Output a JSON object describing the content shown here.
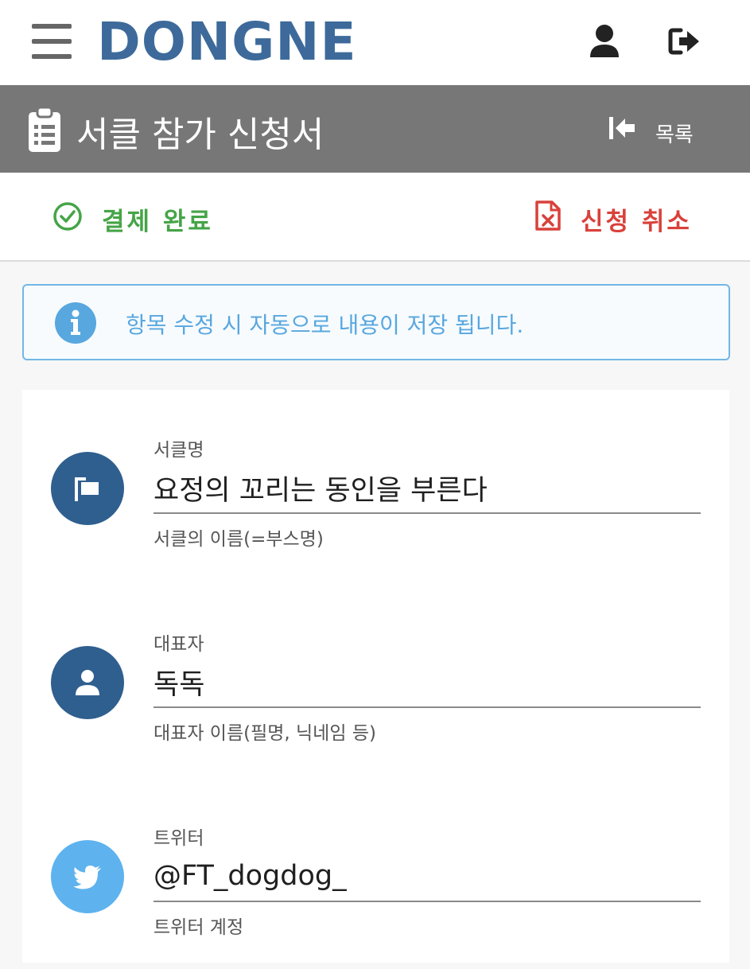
{
  "header": {
    "logo": "DONGNE"
  },
  "titlebar": {
    "title": "서클 참가 신청서",
    "list_label": "목록"
  },
  "status": {
    "paid_label": "결제 완료",
    "cancel_label": "신청 취소"
  },
  "info": {
    "message": "항목 수정 시 자동으로 내용이 저장 됩니다."
  },
  "fields": [
    {
      "label": "서클명",
      "value": "요정의 꼬리는 동인을 부른다",
      "help": "서클의 이름(=부스명)",
      "icon": "flag-icon"
    },
    {
      "label": "대표자",
      "value": "독독",
      "help": "대표자 이름(필명, 닉네임 등)",
      "icon": "user-icon"
    },
    {
      "label": "트위터",
      "value": "@FT_dogdog_",
      "help": "트위터 계정",
      "icon": "twitter-icon"
    }
  ],
  "colors": {
    "brand": "#3d6a9a",
    "titlebar": "#777777",
    "success": "#45a447",
    "danger": "#d9413a",
    "info": "#58a7df",
    "icon_circle": "#2f5f8f",
    "twitter": "#5eb3ee"
  }
}
